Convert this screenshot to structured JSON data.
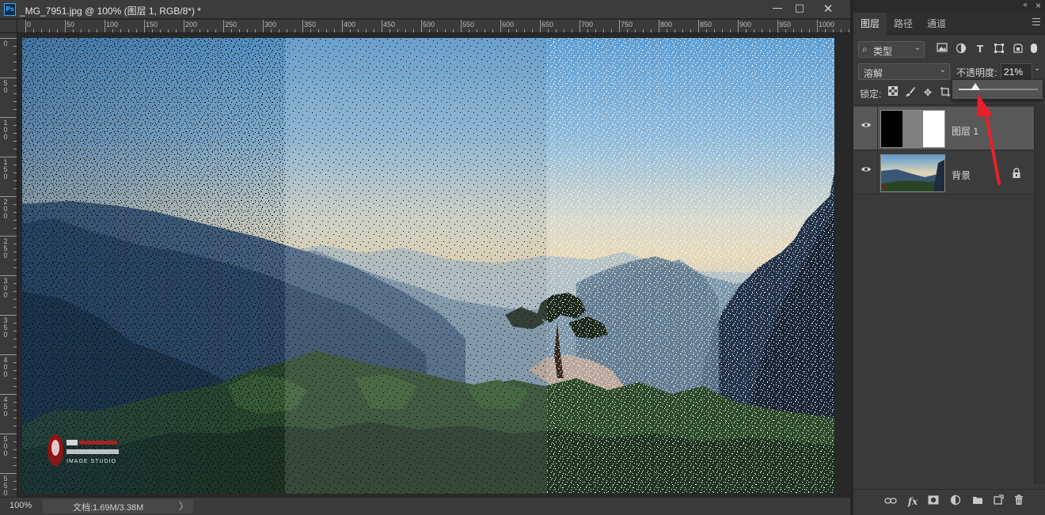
{
  "document": {
    "title": "_MG_7951.jpg @ 100% (图层 1, RGB/8*) *",
    "app_icon": "Ps",
    "window_controls": {
      "minimize_icon": "minimize-icon",
      "maximize_icon": "maximize-icon",
      "close_icon": "close-icon"
    },
    "ruler_top_labels": [
      "0",
      "50",
      "100",
      "150",
      "200",
      "250",
      "300",
      "350",
      "400",
      "450",
      "500",
      "550",
      "600",
      "650",
      "700",
      "750",
      "800",
      "850",
      "900",
      "950",
      "1000"
    ],
    "ruler_left_labels": [
      "0",
      "50",
      "100",
      "150",
      "200",
      "250",
      "300",
      "350",
      "400",
      "450",
      "500",
      "550"
    ],
    "watermark_lettering": "IMAGE STUDIO",
    "status": {
      "zoom": "100%",
      "doc_info": "文档:1.69M/3.38M",
      "arrow": "〉"
    }
  },
  "panel": {
    "collapse_icon": "double-chevron-icon",
    "tabs": [
      {
        "label": "图层",
        "active": true
      },
      {
        "label": "路径",
        "active": false
      },
      {
        "label": "通道",
        "active": false
      }
    ],
    "filter": {
      "search_glyph": "⌕",
      "label": "类型",
      "chevron": "⌄",
      "icons": [
        "image-filter-icon",
        "adjustment-filter-icon",
        "type-filter-icon",
        "shape-filter-icon",
        "smart-object-filter-icon"
      ]
    },
    "blend_mode": {
      "value": "溶解",
      "chevron": "⌄"
    },
    "opacity": {
      "label": "不透明度:",
      "value": "21%",
      "chevron": "⌄",
      "level": 0.21
    },
    "lock": {
      "label": "锁定:",
      "icons": [
        "lock-transparent-icon",
        "lock-image-icon",
        "lock-position-icon",
        "lock-artboard-icon"
      ]
    },
    "layers": [
      {
        "name": "图层 1",
        "visible": true,
        "selected": true,
        "locked": false
      },
      {
        "name": "背景",
        "visible": true,
        "selected": false,
        "locked": true
      }
    ],
    "bottom_icons": [
      "link-layers-icon",
      "fx-icon",
      "add-mask-icon",
      "adjustment-layer-icon",
      "new-group-icon",
      "new-layer-icon",
      "delete-icon"
    ]
  },
  "colors": {
    "app_bg": "#282828",
    "panel_bg": "#3a3a3a",
    "selected_layer": "#585858",
    "annotation_arrow": "#e8202a",
    "ps_blue": "#31a8ff"
  }
}
